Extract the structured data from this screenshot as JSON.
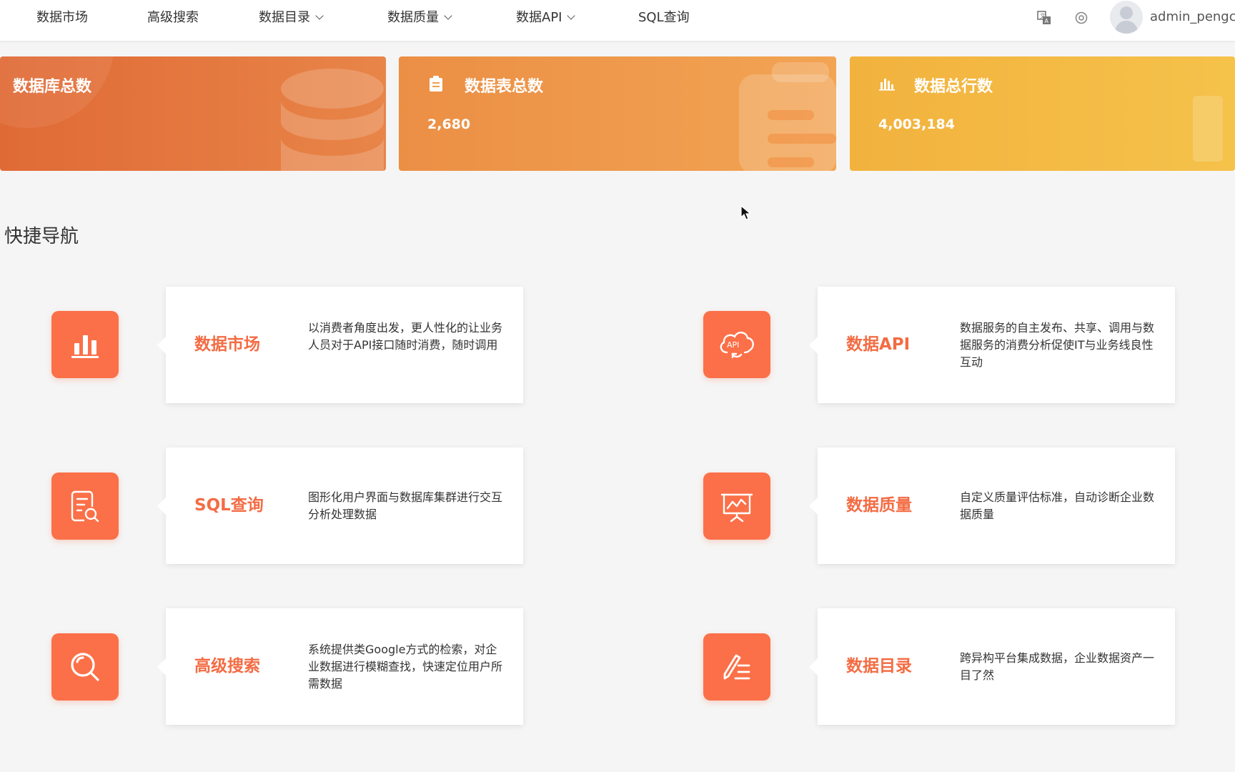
{
  "nav": {
    "items": [
      {
        "label": "数据市场",
        "dropdown": false
      },
      {
        "label": "高级搜索",
        "dropdown": false
      },
      {
        "label": "数据目录",
        "dropdown": true
      },
      {
        "label": "数据质量",
        "dropdown": true
      },
      {
        "label": "数据API",
        "dropdown": true
      },
      {
        "label": "SQL查询",
        "dropdown": false
      }
    ],
    "tools": [
      "translate-icon",
      "settings-icon"
    ],
    "user": {
      "name": "admin_pengcv"
    }
  },
  "stats": [
    {
      "title": "数据库总数",
      "value": "",
      "color": "#e87540",
      "icon": "database-icon"
    },
    {
      "title": "数据表总数",
      "value": "2,680",
      "color": "#f0a050",
      "icon": "clipboard-icon"
    },
    {
      "title": "数据总行数",
      "value": "4,003,184",
      "color": "#f5c048",
      "icon": "bar-chart-icon"
    }
  ],
  "quick_nav": {
    "title": "快捷导航",
    "accent": "#fb7048",
    "items": [
      {
        "title": "数据市场",
        "icon": "bar-chart-icon",
        "desc": "以消费者角度出发，更人性化的让业务人员对于API接口随时消费，随时调用"
      },
      {
        "title": "数据API",
        "icon": "cloud-api-icon",
        "desc": "数据服务的自主发布、共享、调用与数据服务的消费分析促使IT与业务线良性互动"
      },
      {
        "title": "SQL查询",
        "icon": "document-search-icon",
        "desc": "图形化用户界面与数据库集群进行交互分析处理数据"
      },
      {
        "title": "数据质量",
        "icon": "presentation-chart-icon",
        "desc": "自定义质量评估标准，自动诊断企业数据质量"
      },
      {
        "title": "高级搜索",
        "icon": "search-icon",
        "desc": "系统提供类Google方式的检索，对企业数据进行模糊查找，快速定位用户所需数据"
      },
      {
        "title": "数据目录",
        "icon": "edit-list-icon",
        "desc": "跨异构平台集成数据，企业数据资产一目了然"
      }
    ]
  }
}
